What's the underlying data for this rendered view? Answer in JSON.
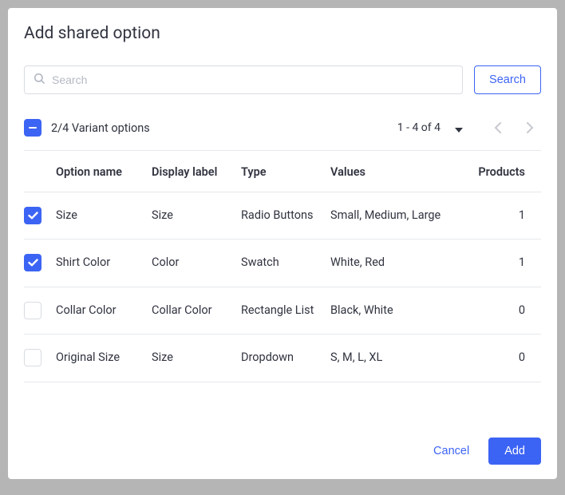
{
  "title": "Add shared option",
  "search": {
    "placeholder": "Search",
    "button": "Search"
  },
  "selection_summary": "2/4 Variant options",
  "range_label": "1 - 4 of 4",
  "columns": {
    "option_name": "Option name",
    "display_label": "Display label",
    "type": "Type",
    "values": "Values",
    "products": "Products"
  },
  "rows": [
    {
      "checked": true,
      "option_name": "Size",
      "display_label": "Size",
      "type": "Radio Buttons",
      "values": "Small, Medium, Large",
      "products": "1"
    },
    {
      "checked": true,
      "option_name": "Shirt Color",
      "display_label": "Color",
      "type": "Swatch",
      "values": "White, Red",
      "products": "1"
    },
    {
      "checked": false,
      "option_name": "Collar Color",
      "display_label": "Collar Color",
      "type": "Rectangle List",
      "values": "Black, White",
      "products": "0"
    },
    {
      "checked": false,
      "option_name": "Original Size",
      "display_label": "Size",
      "type": "Dropdown",
      "values": "S, M, L, XL",
      "products": "0"
    }
  ],
  "footer": {
    "cancel": "Cancel",
    "add": "Add"
  }
}
